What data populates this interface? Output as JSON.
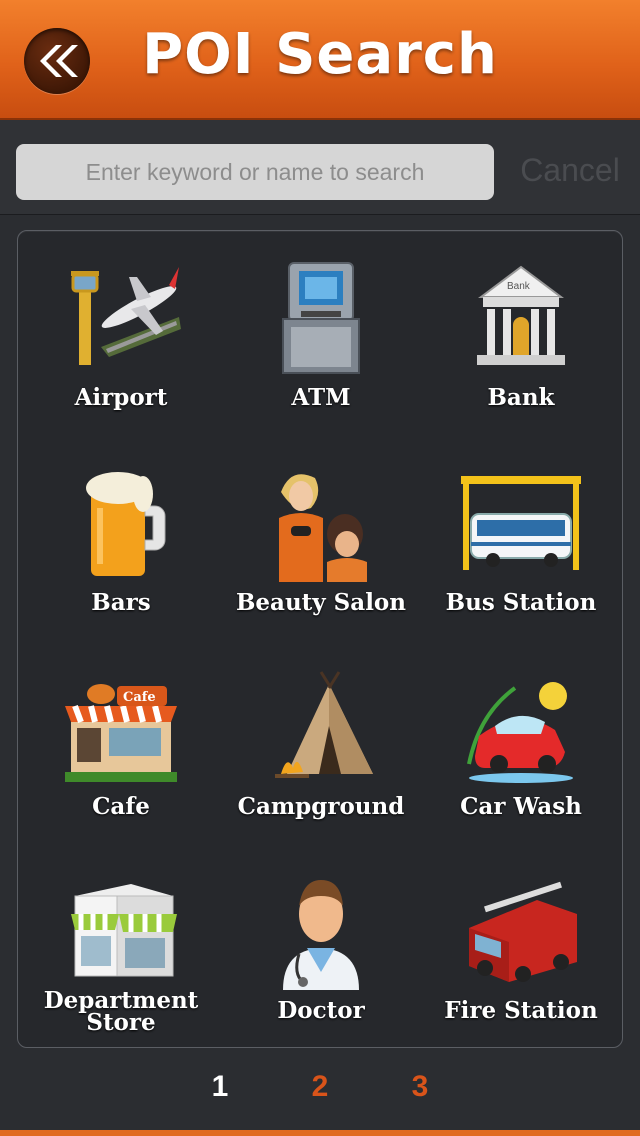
{
  "header": {
    "title": "POI Search"
  },
  "search": {
    "placeholder": "Enter keyword or name to search",
    "cancel_label": "Cancel"
  },
  "categories": [
    {
      "label": "Airport",
      "icon": "airport-icon"
    },
    {
      "label": "ATM",
      "icon": "atm-icon"
    },
    {
      "label": "Bank",
      "icon": "bank-icon"
    },
    {
      "label": "Bars",
      "icon": "beer-icon"
    },
    {
      "label": "Beauty Salon",
      "icon": "hair-salon-icon"
    },
    {
      "label": "Bus Station",
      "icon": "bus-icon"
    },
    {
      "label": "Cafe",
      "icon": "cafe-icon"
    },
    {
      "label": "Campground",
      "icon": "tent-icon"
    },
    {
      "label": "Car Wash",
      "icon": "car-wash-icon"
    },
    {
      "label": "Department Store",
      "icon": "store-icon"
    },
    {
      "label": "Doctor",
      "icon": "doctor-icon"
    },
    {
      "label": "Fire Station",
      "icon": "fire-truck-icon"
    }
  ],
  "pager": {
    "pages": [
      "1",
      "2",
      "3"
    ],
    "current": "1"
  },
  "colors": {
    "accent": "#e8712a",
    "active_page": "#ffffff",
    "inactive_page": "#d9541a"
  }
}
